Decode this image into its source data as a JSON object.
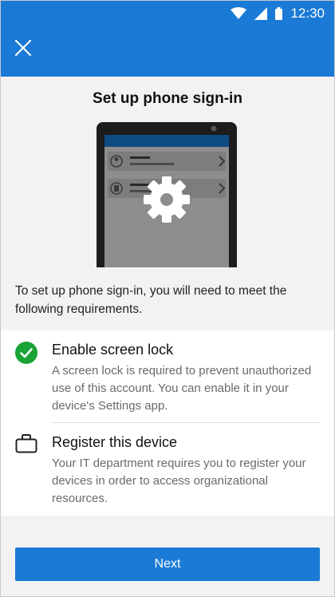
{
  "status_bar": {
    "time": "12:30"
  },
  "header": {
    "close_icon": "close-icon"
  },
  "title": "Set up phone sign-in",
  "intro": "To set up phone sign-in, you will need to meet the following requirements.",
  "requirements": [
    {
      "icon": "check-circle-icon",
      "status_color": "#1aa336",
      "heading": "Enable screen lock",
      "description": "A screen lock is required to prevent unauthorized use of this account. You can enable it in your device's Settings app."
    },
    {
      "icon": "briefcase-icon",
      "heading": "Register this device",
      "description": "Your IT department requires you to register your devices in order to access organizational resources."
    }
  ],
  "next_button": {
    "label": "Next"
  },
  "colors": {
    "accent": "#1a7ad6",
    "success": "#1aa336"
  }
}
